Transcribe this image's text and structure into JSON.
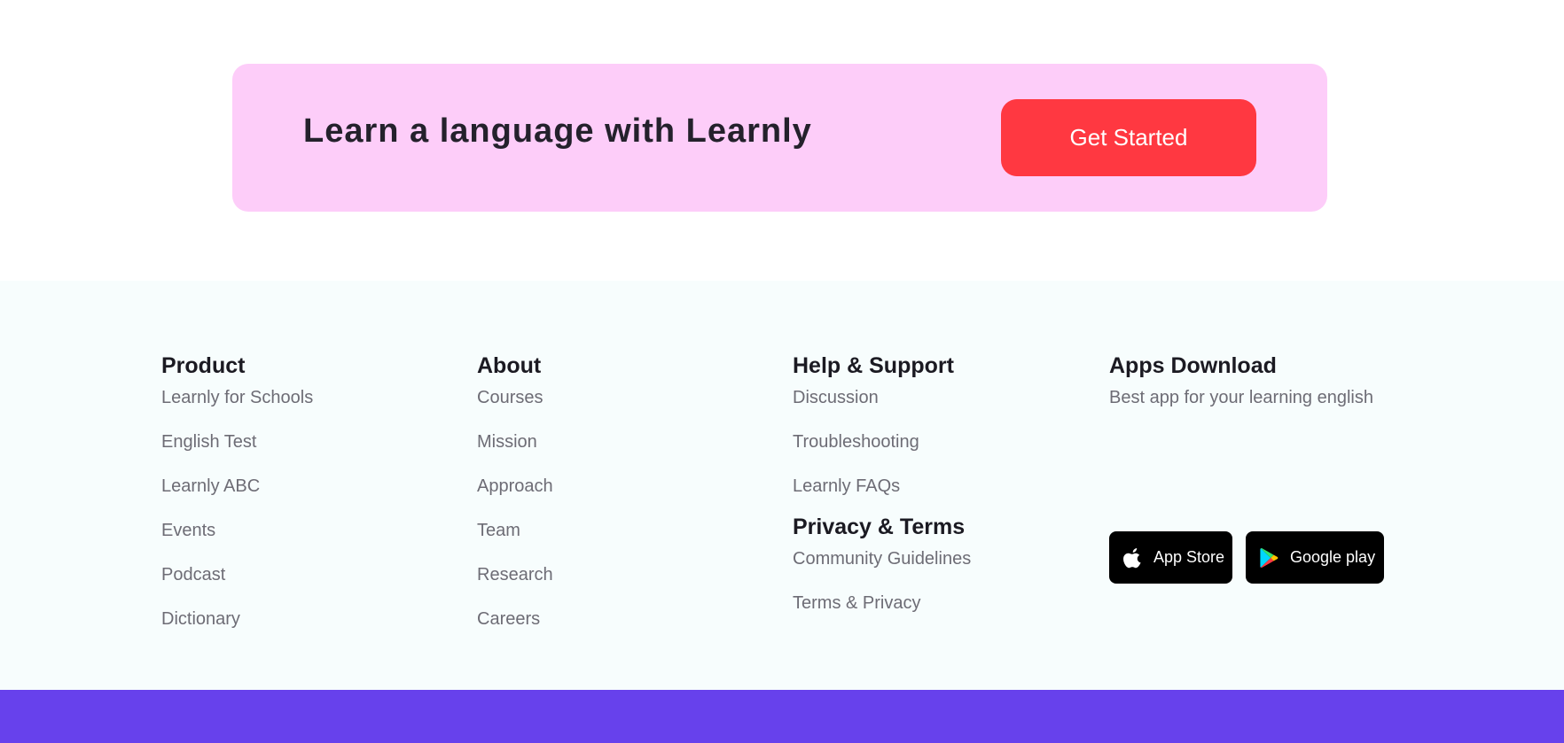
{
  "cta": {
    "title": "Learn a language with Learnly",
    "button_label": "Get Started"
  },
  "footer": {
    "product": {
      "heading": "Product",
      "links": [
        "Learnly for Schools",
        "English Test",
        "Learnly ABC",
        "Events",
        "Podcast",
        "Dictionary"
      ]
    },
    "about": {
      "heading": "About",
      "links": [
        "Courses",
        "Mission",
        "Approach",
        "Team",
        "Research",
        "Careers"
      ]
    },
    "help": {
      "heading": "Help & Support",
      "links": [
        "Discussion",
        "Troubleshooting",
        "Learnly FAQs"
      ]
    },
    "privacy": {
      "heading": "Privacy & Terms",
      "links": [
        "Community Guidelines",
        "Terms & Privacy"
      ]
    },
    "apps": {
      "heading": "Apps Download",
      "description": "Best app for your learning english",
      "app_store_label": "App Store",
      "app_store_icon": "apple-icon",
      "google_play_label": "Google play",
      "google_play_icon": "google-play-icon"
    }
  },
  "colors": {
    "cta_background": "#fdcdf9",
    "cta_button": "#ff3841",
    "footer_background": "#f7fdfd",
    "bottom_bar": "#6741ec",
    "heading_text": "#1b1a22",
    "link_text": "#6d6c75"
  }
}
